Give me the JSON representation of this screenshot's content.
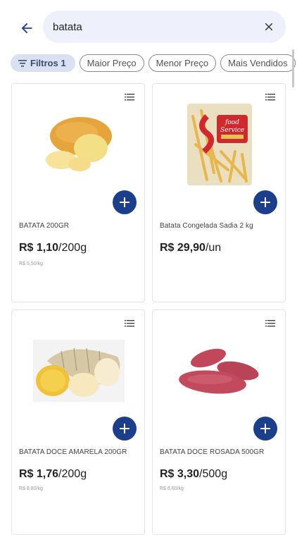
{
  "search": {
    "value": "batata"
  },
  "filters": [
    {
      "label": "Filtros 1",
      "active": true
    },
    {
      "label": "Maior Preço",
      "active": false
    },
    {
      "label": "Menor Preço",
      "active": false
    },
    {
      "label": "Mais Vendidos",
      "active": false
    }
  ],
  "products": [
    {
      "name": "BATATA 200GR",
      "price": "R$ 1,10",
      "unit": "/200g",
      "unit_price": "R$ 5,50/kg",
      "image": "potato"
    },
    {
      "name": "Batata Congelada Sadia 2 kg",
      "price": "R$ 29,90",
      "unit": "/un",
      "unit_price": "",
      "image": "frozen-fries-bag",
      "brand": "food service"
    },
    {
      "name": "BATATA DOCE AMARELA 200GR",
      "price": "R$ 1,76",
      "unit": "/200g",
      "unit_price": "R$ 8,80/kg",
      "image": "yellow-sweet-potato"
    },
    {
      "name": "BATATA DOCE ROSADA 500GR",
      "price": "R$ 3,30",
      "unit": "/500g",
      "unit_price": "R$ 6,60/kg",
      "image": "pink-sweet-potato"
    }
  ],
  "colors": {
    "accent": "#1b3f8b",
    "chip_active_bg": "#d9e1f2",
    "search_bg": "#eef1fb"
  }
}
